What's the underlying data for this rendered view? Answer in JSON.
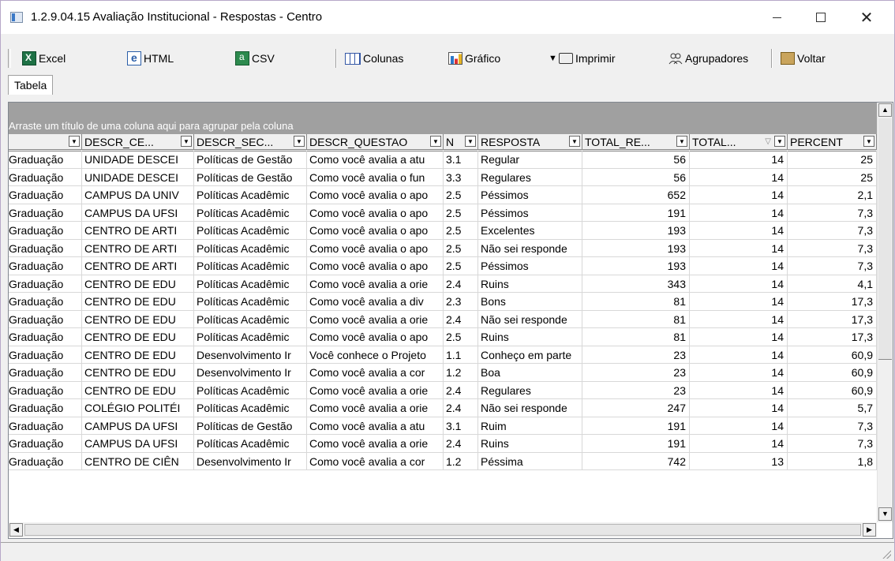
{
  "window": {
    "title": "1.2.9.04.15 Avaliação Institucional - Respostas - Centro",
    "minimize": "",
    "maximize": "",
    "close": "✕"
  },
  "toolbar": {
    "excel": "Excel",
    "html": "HTML",
    "csv": "CSV",
    "colunas": "Colunas",
    "grafico": "Gráfico",
    "imprimir": "Imprimir",
    "agrupadores": "Agrupadores",
    "voltar": "Voltar"
  },
  "tabs": [
    "Tabela"
  ],
  "grid": {
    "group_hint": "Arraste um título de uma coluna aqui para agrupar pela coluna",
    "columns": [
      "",
      "DESCR_CE...",
      "DESCR_SEC...",
      "DESCR_QUESTAO",
      "N",
      "RESPOSTA",
      "TOTAL_RE...",
      "TOTAL...",
      "PERCENT"
    ],
    "rows": [
      [
        "Graduação",
        "UNIDADE DESCEI",
        "Políticas de Gestão",
        "Como você avalia a atu",
        "3.1",
        "Regular",
        "56",
        "14",
        "25"
      ],
      [
        "Graduação",
        "UNIDADE DESCEI",
        "Políticas de Gestão",
        "Como você avalia o fun",
        "3.3",
        "Regulares",
        "56",
        "14",
        "25"
      ],
      [
        "Graduação",
        "CAMPUS DA UNIV",
        "Políticas Acadêmic",
        "Como você avalia o apo",
        "2.5",
        "Péssimos",
        "652",
        "14",
        "2,1"
      ],
      [
        "Graduação",
        "CAMPUS DA UFSI",
        "Políticas Acadêmic",
        "Como você avalia o apo",
        "2.5",
        "Péssimos",
        "191",
        "14",
        "7,3"
      ],
      [
        "Graduação",
        "CENTRO DE ARTI",
        "Políticas Acadêmic",
        "Como você avalia o apo",
        "2.5",
        "Excelentes",
        "193",
        "14",
        "7,3"
      ],
      [
        "Graduação",
        "CENTRO DE ARTI",
        "Políticas Acadêmic",
        "Como você avalia o apo",
        "2.5",
        "Não sei responde",
        "193",
        "14",
        "7,3"
      ],
      [
        "Graduação",
        "CENTRO DE ARTI",
        "Políticas Acadêmic",
        "Como você avalia o apo",
        "2.5",
        "Péssimos",
        "193",
        "14",
        "7,3"
      ],
      [
        "Graduação",
        "CENTRO DE EDU",
        "Políticas Acadêmic",
        "Como você avalia a orie",
        "2.4",
        "Ruins",
        "343",
        "14",
        "4,1"
      ],
      [
        "Graduação",
        "CENTRO DE EDU",
        "Políticas Acadêmic",
        "Como você avalia a div",
        "2.3",
        "Bons",
        "81",
        "14",
        "17,3"
      ],
      [
        "Graduação",
        "CENTRO DE EDU",
        "Políticas Acadêmic",
        "Como você avalia a orie",
        "2.4",
        "Não sei responde",
        "81",
        "14",
        "17,3"
      ],
      [
        "Graduação",
        "CENTRO DE EDU",
        "Políticas Acadêmic",
        "Como você avalia o apo",
        "2.5",
        "Ruins",
        "81",
        "14",
        "17,3"
      ],
      [
        "Graduação",
        "CENTRO DE EDU",
        "Desenvolvimento Ir",
        "Você conhece o Projeto",
        "1.1",
        "Conheço em parte",
        "23",
        "14",
        "60,9"
      ],
      [
        "Graduação",
        "CENTRO DE EDU",
        "Desenvolvimento Ir",
        "Como você avalia a cor",
        "1.2",
        "Boa",
        "23",
        "14",
        "60,9"
      ],
      [
        "Graduação",
        "CENTRO DE EDU",
        "Políticas Acadêmic",
        "Como você avalia a orie",
        "2.4",
        "Regulares",
        "23",
        "14",
        "60,9"
      ],
      [
        "Graduação",
        "COLÉGIO POLITÉI",
        "Políticas Acadêmic",
        "Como você avalia a orie",
        "2.4",
        "Não sei responde",
        "247",
        "14",
        "5,7"
      ],
      [
        "Graduação",
        "CAMPUS DA UFSI",
        "Políticas de Gestão",
        "Como você avalia a atu",
        "3.1",
        "Ruim",
        "191",
        "14",
        "7,3"
      ],
      [
        "Graduação",
        "CAMPUS DA UFSI",
        "Políticas Acadêmic",
        "Como você avalia a orie",
        "2.4",
        "Ruins",
        "191",
        "14",
        "7,3"
      ],
      [
        "Graduação",
        "CENTRO DE CIÊN",
        "Desenvolvimento Ir",
        "Como você avalia a cor",
        "1.2",
        "Péssima",
        "742",
        "13",
        "1,8"
      ]
    ]
  },
  "icons": {
    "excel": "excel-icon",
    "html": "html-icon",
    "csv": "csv-icon",
    "colunas": "columns-icon",
    "grafico": "chart-icon",
    "imprimir": "printer-icon",
    "agrupadores": "group-icon",
    "voltar": "back-icon"
  }
}
